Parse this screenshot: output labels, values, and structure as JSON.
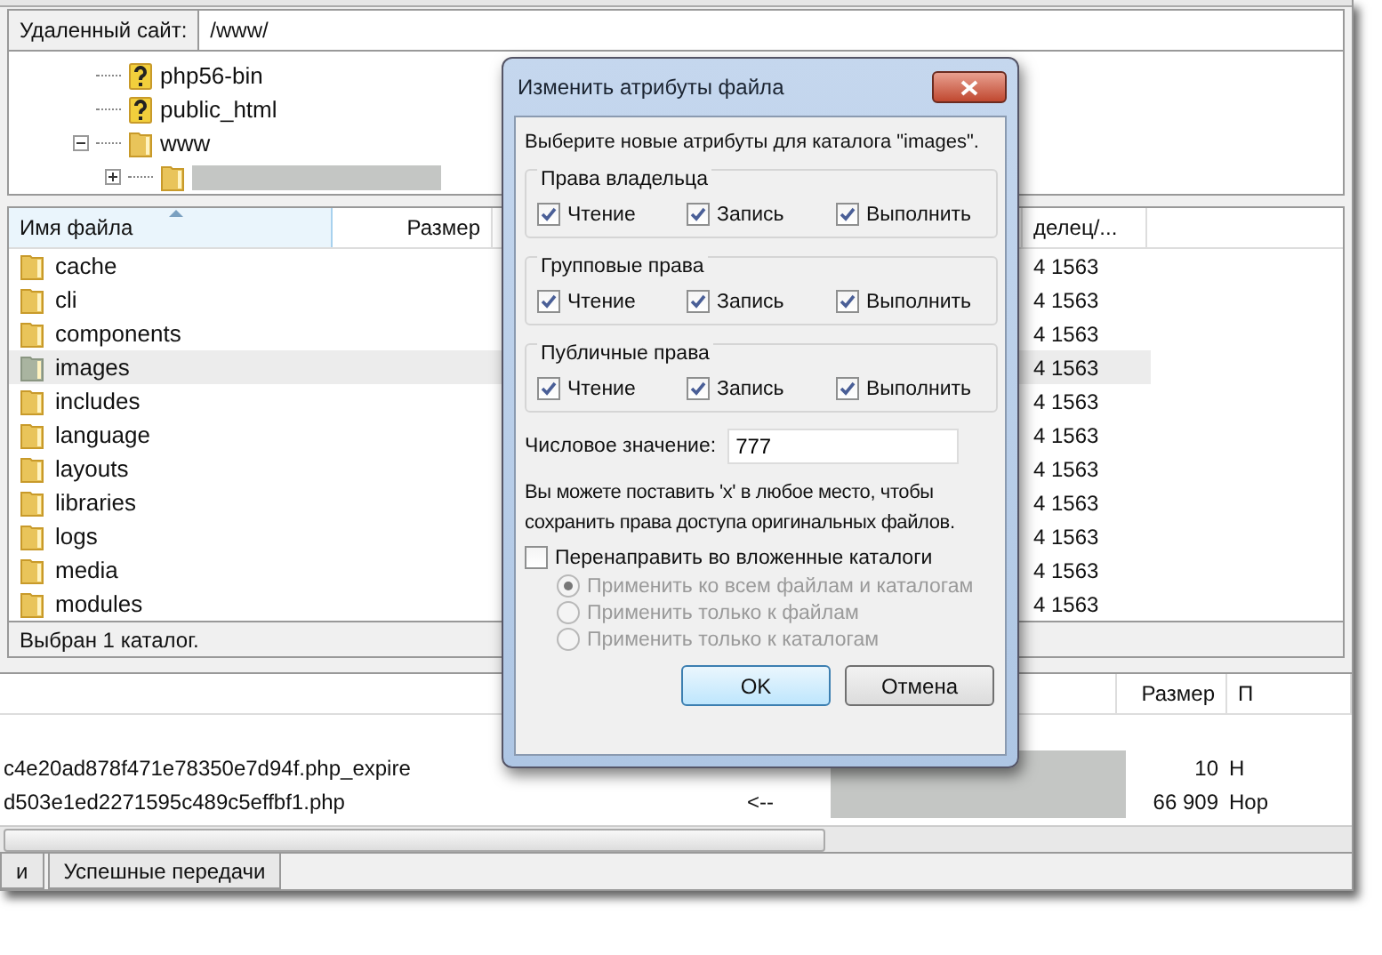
{
  "remote_site": {
    "label": "Удаленный сайт:",
    "value": "/www/"
  },
  "tree": [
    {
      "kind": "unknown",
      "label": "php56-bin"
    },
    {
      "kind": "unknown",
      "label": "public_html"
    },
    {
      "kind": "folder",
      "label": "www",
      "expanded": true,
      "children": [
        {
          "kind": "hidden",
          "expanded": false
        }
      ]
    }
  ],
  "file_list": {
    "columns": [
      {
        "label": "Имя файла",
        "sorted": true
      },
      {
        "label": "Размер",
        "sorted": false
      },
      {
        "label": "делец/...",
        "sorted": false
      }
    ],
    "rows": [
      {
        "name": "cache",
        "owner": "4 1563",
        "selected": false
      },
      {
        "name": "cli",
        "owner": "4 1563",
        "selected": false
      },
      {
        "name": "components",
        "owner": "4 1563",
        "selected": false
      },
      {
        "name": "images",
        "owner": "4 1563",
        "selected": true
      },
      {
        "name": "includes",
        "owner": "4 1563",
        "selected": false
      },
      {
        "name": "language",
        "owner": "4 1563",
        "selected": false
      },
      {
        "name": "layouts",
        "owner": "4 1563",
        "selected": false
      },
      {
        "name": "libraries",
        "owner": "4 1563",
        "selected": false
      },
      {
        "name": "logs",
        "owner": "4 1563",
        "selected": false
      },
      {
        "name": "media",
        "owner": "4 1563",
        "selected": false
      },
      {
        "name": "modules",
        "owner": "4 1563",
        "selected": false
      }
    ]
  },
  "status": "Выбран 1 каталог.",
  "queue": {
    "columns": [
      "Размер",
      "П"
    ],
    "rows": [
      {
        "name": "c4e20ad878f471e78350e7d94f.php_expire",
        "redacted": true,
        "size": "10",
        "priority": "Н"
      },
      {
        "name": "d503e1ed2271595c489c5effbf1.php",
        "direction": "<--",
        "redacted": true,
        "size": "66 909",
        "priority": "Нор"
      }
    ]
  },
  "bottom_tabs": [
    {
      "label": "и",
      "selected": false
    },
    {
      "label": "Успешные передачи",
      "selected": false
    }
  ],
  "dialog": {
    "title": "Изменить атрибуты файла",
    "prompt": "Выберите новые атрибуты для каталога \"images\".",
    "groups": [
      {
        "title": "Права владельца",
        "perms": [
          {
            "label": "Чтение",
            "checked": true
          },
          {
            "label": "Запись",
            "checked": true
          },
          {
            "label": "Выполнить",
            "checked": true
          }
        ]
      },
      {
        "title": "Групповые права",
        "perms": [
          {
            "label": "Чтение",
            "checked": true
          },
          {
            "label": "Запись",
            "checked": true
          },
          {
            "label": "Выполнить",
            "checked": true
          }
        ]
      },
      {
        "title": "Публичные права",
        "perms": [
          {
            "label": "Чтение",
            "checked": true
          },
          {
            "label": "Запись",
            "checked": true
          },
          {
            "label": "Выполнить",
            "checked": true
          }
        ]
      }
    ],
    "numeric": {
      "label": "Числовое значение:",
      "value": "777"
    },
    "hint": "Вы можете поставить 'x' в любое место, чтобы сохранить права доступа оригинальных файлов.",
    "recursive": {
      "label": "Перенаправить во вложенные каталоги",
      "checked": false
    },
    "options": [
      {
        "label": "Применить ко всем файлам и каталогам",
        "selected": true,
        "disabled": true
      },
      {
        "label": "Применить только к файлам",
        "selected": false,
        "disabled": true
      },
      {
        "label": "Применить только к каталогам",
        "selected": false,
        "disabled": true
      }
    ],
    "buttons": [
      {
        "label": "OK",
        "kind": "default"
      },
      {
        "label": "Отмена",
        "kind": "normal"
      }
    ]
  }
}
